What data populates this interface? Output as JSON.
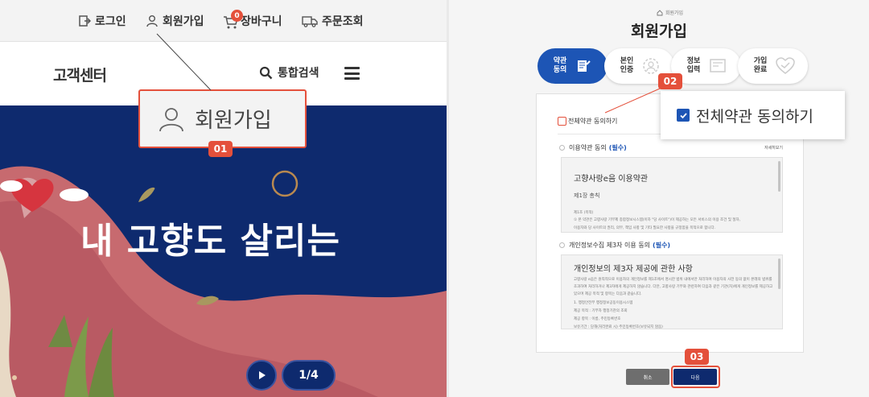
{
  "topbar": {
    "login": "로그인",
    "signup": "회원가입",
    "cart": "장바구니",
    "cart_count": "0",
    "orders": "주문조회"
  },
  "header": {
    "logo": "고객센터",
    "search_label": "통합검색"
  },
  "banner": {
    "headline": "내 고향도 살리는",
    "pager": "1/4"
  },
  "callouts": {
    "c01_text": "회원가입",
    "c01_badge": "01",
    "c02_text": "전체약관 동의하기",
    "c02_badge": "02",
    "c03_badge": "03"
  },
  "signup_page": {
    "title": "회원가입",
    "steps": [
      {
        "label": "약관\n동의",
        "active": true
      },
      {
        "label": "본인\n인증",
        "active": false
      },
      {
        "label": "정보\n입력",
        "active": false
      },
      {
        "label": "가입\n완료",
        "active": false
      }
    ],
    "agree_all": "전체약관 동의하기",
    "terms": {
      "label": "이용약관 동의",
      "required": "(필수)",
      "more": "자세히보기",
      "doc_title": "고향사랑e음 이용약관",
      "chapter": "제1장 총칙",
      "article": "제1조 (목적)",
      "line1": "① 본 약관은 고향사랑 기부제 종합정보시스템(이하 \"당 사이트\")이 제공하는 모든 서비스의 이용 조건 및 절차,",
      "line2": "이용자와 당 사이트의 권리, 의무, 책임 사항 및 기타 필요한 사항을 규정함을 목적으로 합니다."
    },
    "privacy": {
      "label": "개인정보수집 제3자 이용 동의",
      "required": "(필수)",
      "doc_title": "개인정보의 제3자 제공에 관한 사항",
      "line1": "고향사랑 e음은 원칙적으로 이용자의 개인정보를 제1조에서 명시한 범위 내에서만 처리하며 이용자의 사전 동의 없이 본래의 범위를",
      "line2": "초과하여 처리하거나 제3자에게 제공하지 않습니다. 다만, 고향사랑 기부와 관련하여 다음과 같은 기관(자)에게 개인정보를 제공하고",
      "line3": "있으며 제공 목적 및 항목는 다음과 같습니다.",
      "line4": "1. 행정안전부 행정정보공동이용시스템",
      "line5": "제공 목적 : 기부자 행정기관의 조회",
      "line6": "제공 항목 : 이름, 주민등록번호",
      "line7": "보유기간 : 당해(처리완료 시) 주민등록번호(보유되지 않음)"
    },
    "buttons": {
      "cancel": "취소",
      "next": "다음"
    },
    "home_crumb": "회원가입"
  }
}
